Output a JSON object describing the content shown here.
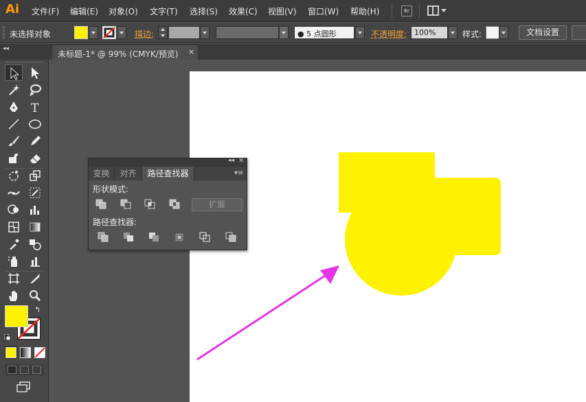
{
  "app": {
    "logo": "Ai"
  },
  "menu": [
    "文件(F)",
    "编辑(E)",
    "对象(O)",
    "文字(T)",
    "选择(S)",
    "效果(C)",
    "视图(V)",
    "窗口(W)",
    "帮助(H)"
  ],
  "menubar_extra": {
    "bridge": "Br"
  },
  "controlbar": {
    "selection_status": "未选择对象",
    "fill_color": "#fff200",
    "stroke_label": "描边:",
    "brush_value": "● 5 点圆形",
    "opacity_label": "不透明度:",
    "opacity_value": "100%",
    "style_label": "样式:",
    "doc_setup_button": "文档设置"
  },
  "document": {
    "tab_title": "未标题-1* @ 99% (CMYK/预览)",
    "close": "×"
  },
  "pathfinder_panel": {
    "tabs": [
      "变换",
      "对齐",
      "路径查找器"
    ],
    "active_tab": 2,
    "shape_modes_label": "形状模式:",
    "expand_button": "扩展",
    "pathfinders_label": "路径查找器:",
    "collapse": "◂◂",
    "close": "✕",
    "menu": "▾≡"
  },
  "artwork": {
    "shape_color": "#fff200",
    "arrow_color": "#e633e6",
    "shapes": [
      "rectangle",
      "rounded-rectangle",
      "circle"
    ]
  },
  "tools_panel": {
    "collapse": "◂◂",
    "fill_color": "#fff200",
    "stroke_color": "none"
  }
}
